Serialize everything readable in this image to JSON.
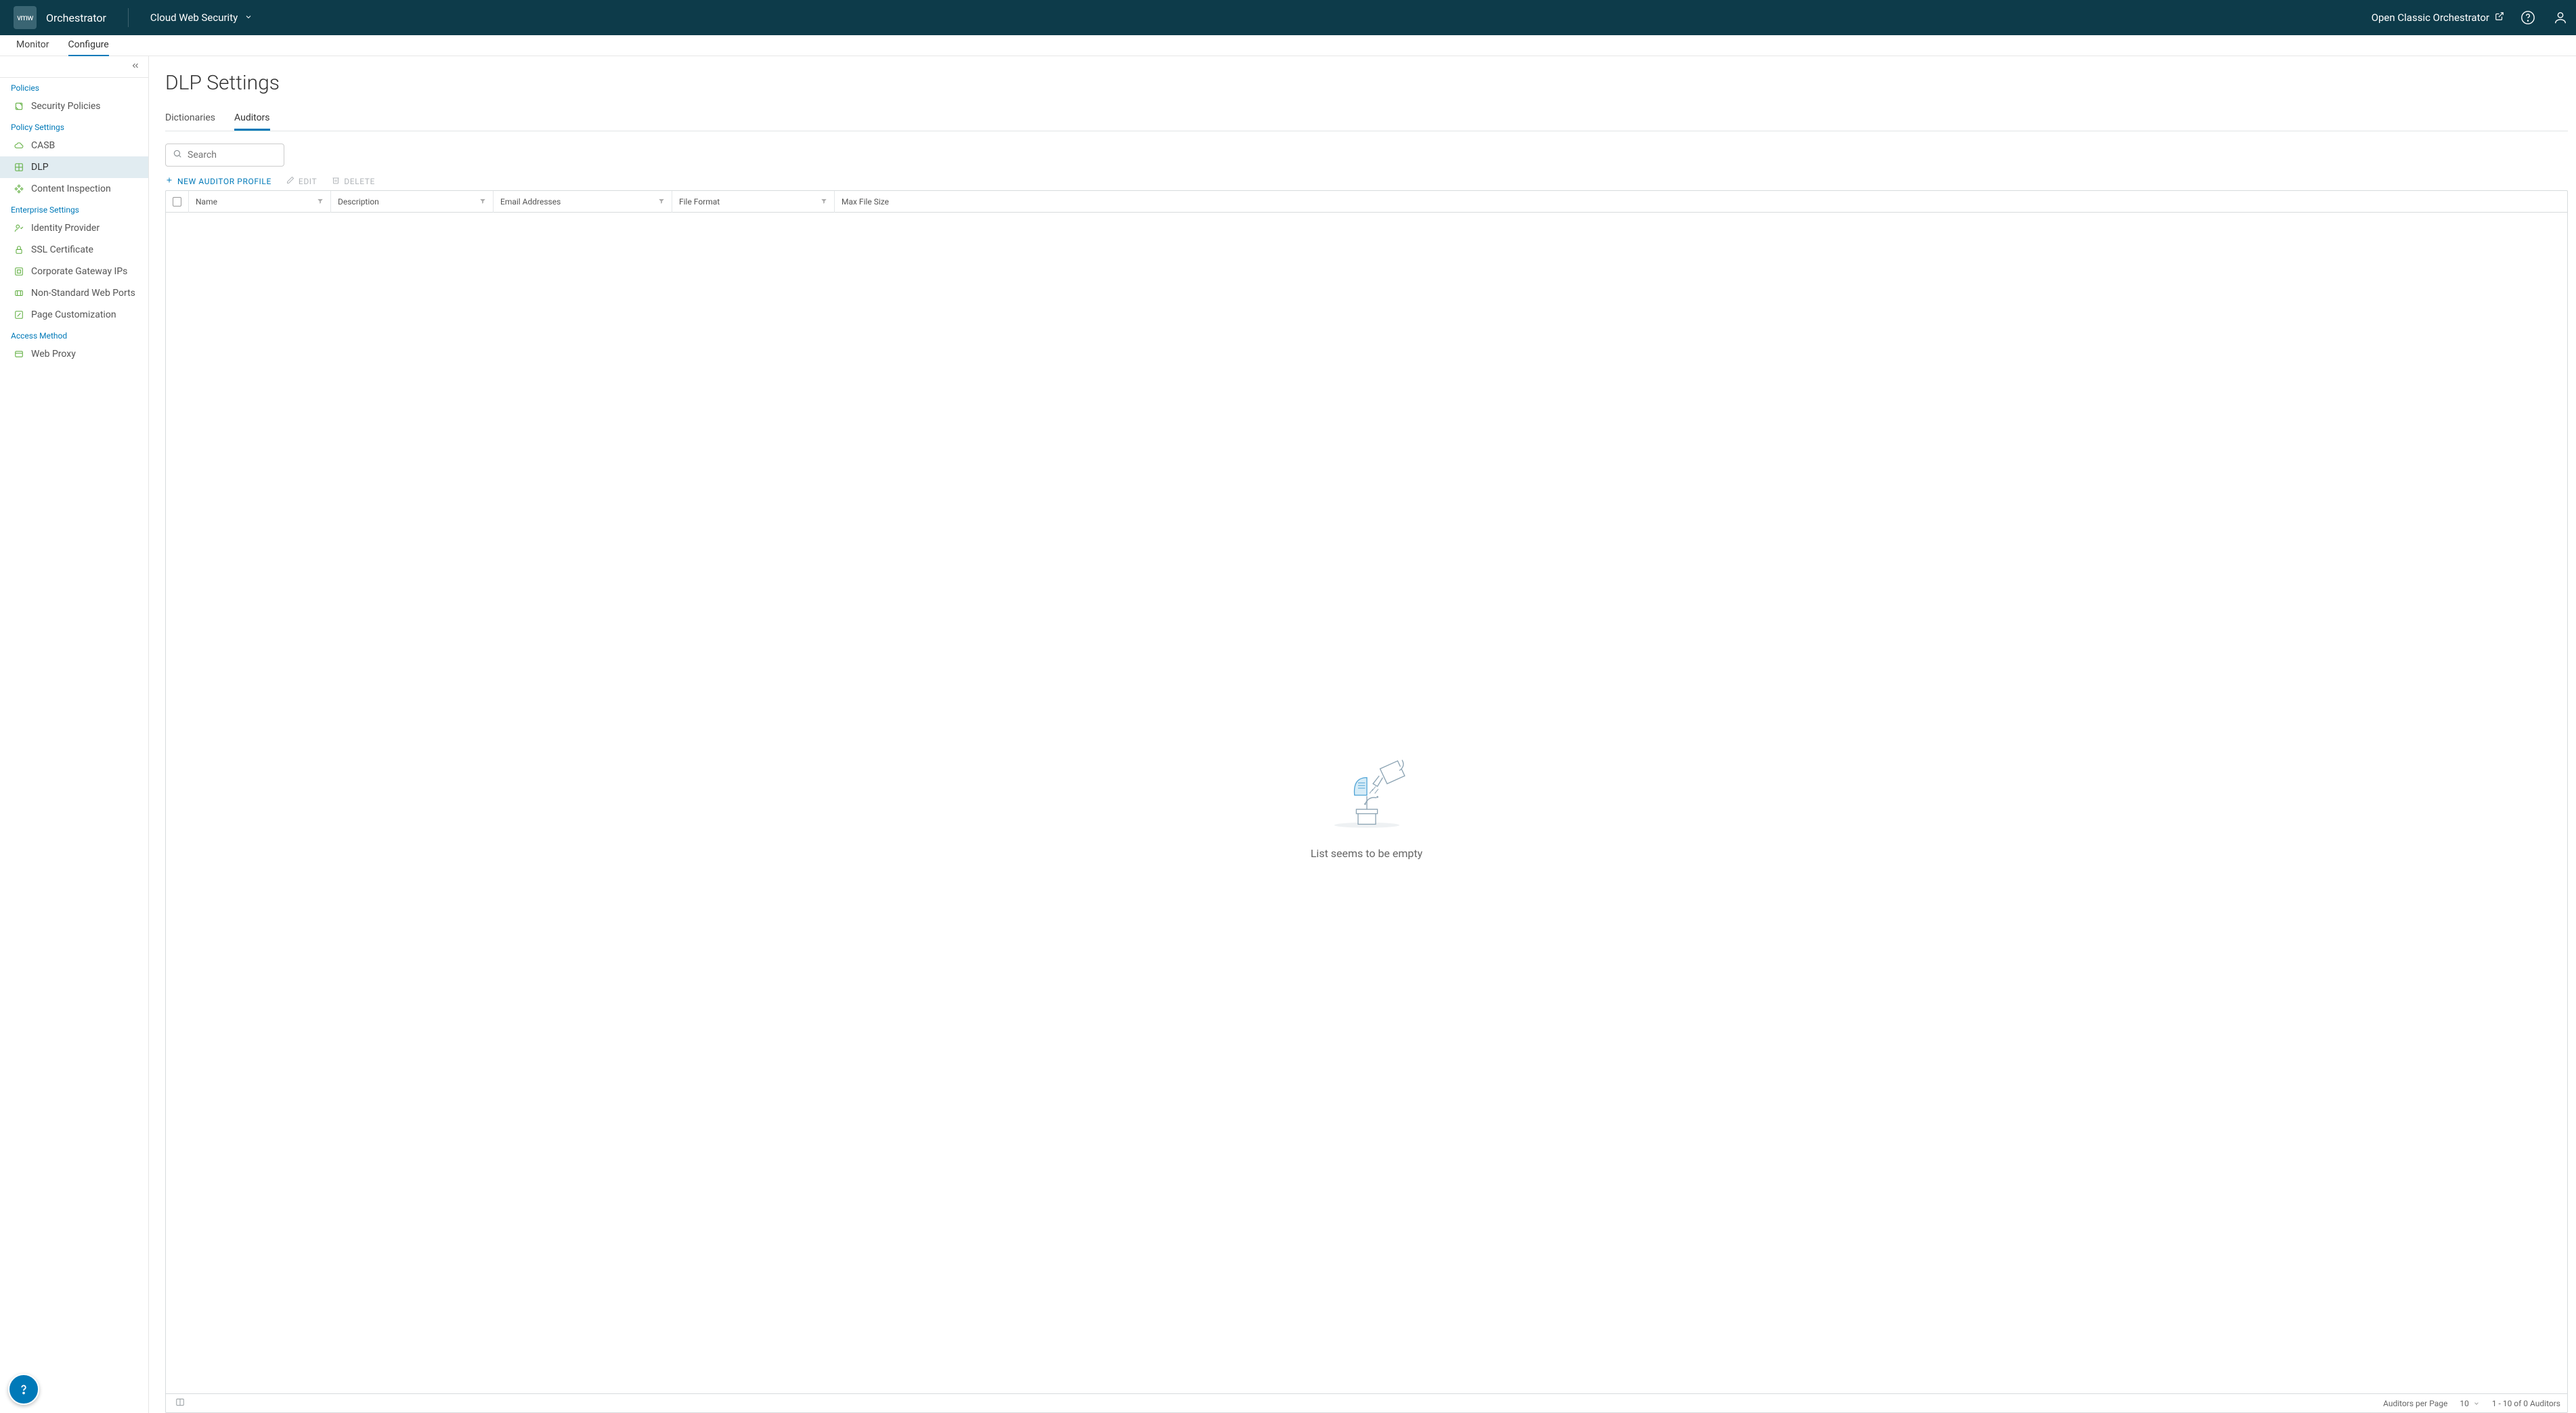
{
  "brand": {
    "logo": "vmw",
    "name": "Orchestrator"
  },
  "context": "Cloud Web Security",
  "classic_link": "Open Classic Orchestrator",
  "main_tabs": {
    "monitor": "Monitor",
    "configure": "Configure"
  },
  "sidebar": {
    "groups": {
      "policies": "Policies",
      "policy_settings": "Policy Settings",
      "enterprise_settings": "Enterprise Settings",
      "access_method": "Access Method"
    },
    "items": {
      "security_policies": "Security Policies",
      "casb": "CASB",
      "dlp": "DLP",
      "content_inspection": "Content Inspection",
      "identity_provider": "Identity Provider",
      "ssl_certificate": "SSL Certificate",
      "corporate_gateway_ips": "Corporate Gateway IPs",
      "non_standard_web_ports": "Non-Standard Web Ports",
      "page_customization": "Page Customization",
      "web_proxy": "Web Proxy"
    }
  },
  "page": {
    "title": "DLP Settings"
  },
  "subtabs": {
    "dictionaries": "Dictionaries",
    "auditors": "Auditors"
  },
  "search_placeholder": "Search",
  "actions": {
    "new": "NEW AUDITOR PROFILE",
    "edit": "EDIT",
    "delete": "DELETE"
  },
  "columns": {
    "name": "Name",
    "description": "Description",
    "email": "Email Addresses",
    "file_format": "File Format",
    "max_file_size": "Max File Size"
  },
  "empty_message": "List seems to be empty",
  "footer": {
    "per_page_label": "Auditors per Page",
    "per_page_value": "10",
    "range": "1 - 10 of 0 Auditors"
  }
}
